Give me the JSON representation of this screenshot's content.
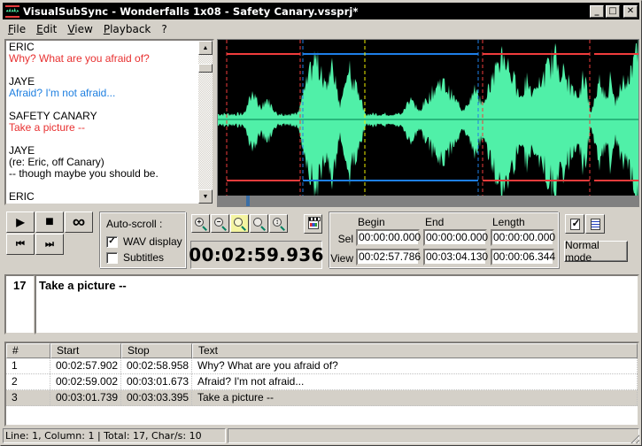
{
  "window": {
    "title": "VisualSubSync - Wonderfalls 1x08 - Safety Canary.vssprj*",
    "minimize_glyph": "_",
    "maximize_glyph": "□",
    "close_glyph": "✕"
  },
  "menu": [
    {
      "label": "File",
      "accel": "F",
      "rest": "ile"
    },
    {
      "label": "Edit",
      "accel": "E",
      "rest": "dit"
    },
    {
      "label": "View",
      "accel": "V",
      "rest": "iew"
    },
    {
      "label": "Playback",
      "accel": "P",
      "rest": "layback"
    },
    {
      "label": "?",
      "accel": "",
      "rest": "?"
    }
  ],
  "script": {
    "lines": [
      {
        "text": "ERIC",
        "style": "name"
      },
      {
        "text": "Why? What are you afraid of?",
        "style": "red"
      },
      {
        "text": "",
        "style": "name"
      },
      {
        "text": "JAYE",
        "style": "name"
      },
      {
        "text": "Afraid? I'm not afraid...",
        "style": "blue"
      },
      {
        "text": "",
        "style": "name"
      },
      {
        "text": "SAFETY CANARY",
        "style": "name"
      },
      {
        "text": "Take a picture --",
        "style": "red"
      },
      {
        "text": "",
        "style": "name"
      },
      {
        "text": "JAYE",
        "style": "name"
      },
      {
        "text": "(re: Eric, off Canary)",
        "style": "name"
      },
      {
        "text": "-- though maybe you should be.",
        "style": "name"
      },
      {
        "text": "",
        "style": "name"
      },
      {
        "text": "ERIC",
        "style": "name"
      }
    ]
  },
  "waveform": {
    "colors": {
      "wave": "#50f0a8",
      "red": "#f03c3c",
      "blue": "#1e7fe8",
      "yellow": "#f0f000",
      "center": "#008050"
    }
  },
  "playback": {
    "play_glyph": "▶",
    "stop_glyph": "■",
    "loop_glyph": "∞",
    "prev_glyph": "⏮",
    "next_glyph": "⏭"
  },
  "autoscroll": {
    "label": "Auto-scroll :",
    "wav_display": {
      "label": "WAV display",
      "checked": true
    },
    "subtitles": {
      "label": "Subtitles",
      "checked": false
    }
  },
  "zoom_buttons": [
    "zoom-in",
    "zoom-out",
    "zoom-selection",
    "zoom-all",
    "zoom-vertical"
  ],
  "time_display": "00:02:59.936",
  "times": {
    "headers": {
      "begin": "Begin",
      "end": "End",
      "length": "Length"
    },
    "sel": {
      "label": "Sel",
      "begin": "00:00:00.000",
      "end": "00:00:00.000",
      "length": "00:00:00.000"
    },
    "view": {
      "label": "View",
      "begin": "00:02:57.786",
      "end": "00:03:04.130",
      "length": "00:00:06.344"
    }
  },
  "mode_button": "Normal mode",
  "editor": {
    "index": "17",
    "text": "Take a picture --"
  },
  "list": {
    "headers": [
      "#",
      "Start",
      "Stop",
      "Text"
    ],
    "rows": [
      {
        "num": "1",
        "start": "00:02:57.902",
        "stop": "00:02:58.958",
        "text": "Why? What are you afraid of?"
      },
      {
        "num": "2",
        "start": "00:02:59.002",
        "stop": "00:03:01.673",
        "text": "Afraid? I'm not afraid..."
      },
      {
        "num": "3",
        "start": "00:03:01.739",
        "stop": "00:03:03.395",
        "text": "Take a picture --"
      }
    ],
    "selected_row": 3
  },
  "status": {
    "left": "Line: 1, Column: 1 | Total: 17, Char/s: 10",
    "right": ""
  }
}
